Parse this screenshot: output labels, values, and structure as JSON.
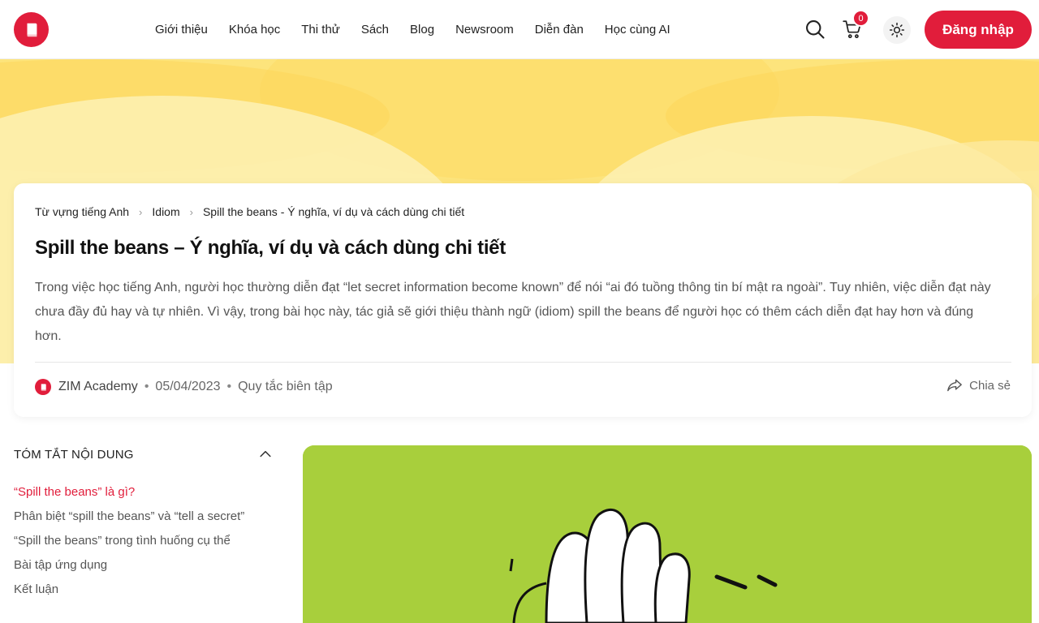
{
  "header": {
    "logo_icon": "book-icon",
    "nav": [
      {
        "label": "Giới thiệu"
      },
      {
        "label": "Khóa học"
      },
      {
        "label": "Thi thử"
      },
      {
        "label": "Sách"
      },
      {
        "label": "Blog"
      },
      {
        "label": "Newsroom"
      },
      {
        "label": "Diễn đàn"
      },
      {
        "label": "Học cùng AI"
      }
    ],
    "cart_count": "0",
    "login_label": "Đăng nhập",
    "accent_color": "#e11d3b"
  },
  "article": {
    "breadcrumb": [
      {
        "label": "Từ vựng tiếng Anh"
      },
      {
        "label": "Idiom"
      },
      {
        "label": "Spill the beans - Ý nghĩa, ví dụ và cách dùng chi tiết"
      }
    ],
    "title": "Spill the beans – Ý nghĩa, ví dụ và cách dùng chi tiết",
    "intro": "Trong việc học tiếng Anh, người học thường diễn đạt “let secret information become known” để nói “ai đó tuồng thông tin bí mật ra ngoài”. Tuy nhiên, việc diễn đạt này chưa đầy đủ hay và tự nhiên. Vì vậy, trong bài học này, tác giả sẽ giới thiệu thành ngữ (idiom) spill the beans để người học có thêm cách diễn đạt hay hơn và đúng hơn.",
    "author": "ZIM Academy",
    "date": "05/04/2023",
    "editorial_rules": "Quy tắc biên tập",
    "share_label": "Chia sẻ"
  },
  "toc": {
    "title": "TÓM TẮT NỘI DUNG",
    "items": [
      {
        "label": "“Spill the beans” là gì?",
        "active": true
      },
      {
        "label": "Phân biệt “spill the beans” và “tell a secret”",
        "active": false
      },
      {
        "label": "“Spill the beans” trong tình huống cụ thể",
        "active": false
      },
      {
        "label": "Bài tập ứng dụng",
        "active": false
      },
      {
        "label": "Kết luận",
        "active": false
      }
    ]
  },
  "feature_image": {
    "background": "#a8cf3c",
    "subject": "hand-illustration"
  }
}
